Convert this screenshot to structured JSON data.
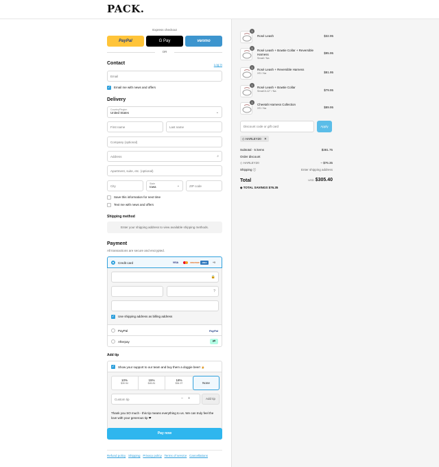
{
  "brand": {
    "logo": "PACK."
  },
  "express": {
    "label": "Express checkout",
    "paypal": "PayPal",
    "gpay": "G Pay",
    "venmo": "venmo",
    "or": "OR"
  },
  "contact": {
    "title": "Contact",
    "login": "Log in",
    "email_placeholder": "Email",
    "news_label": "Email me with news and offers"
  },
  "delivery": {
    "title": "Delivery",
    "country_label": "Country/Region",
    "country_value": "United States",
    "first_name": "First name",
    "last_name": "Last name",
    "company": "Company (optional)",
    "address": "Address",
    "apartment": "Apartment, suite, etc. (optional)",
    "city": "City",
    "state_label": "State",
    "state_value": "Iowa",
    "zip": "ZIP code",
    "save_info": "Save this information for next time",
    "text_me": "Text me with news and offers"
  },
  "shipping_method": {
    "title": "Shipping method",
    "notice": "Enter your shipping address to view available shipping methods."
  },
  "payment": {
    "title": "Payment",
    "subtitle": "All transactions are secure and encrypted.",
    "credit_card": "Credit card",
    "card_brands": [
      "VISA",
      "MC",
      "DISCOVER",
      "AMEX",
      "+5"
    ],
    "billing_same": "Use shipping address as billing address",
    "paypal": "PayPal",
    "paypal_logo": "PayPal",
    "afterpay": "Afterpay"
  },
  "tip": {
    "title": "Add tip",
    "support_label": "Show your support to our team and buy them a doggie beer! 🍺",
    "options": [
      {
        "pct": "10%",
        "amount": "$30.54"
      },
      {
        "pct": "15%",
        "amount": "$45.81"
      },
      {
        "pct": "18%",
        "amount": "$54.97"
      },
      {
        "pct": "None",
        "amount": ""
      }
    ],
    "custom_placeholder": "Custom tip",
    "minus": "−",
    "plus": "+",
    "add_button": "Add tip",
    "thanks": "Thank you SO much - this tip means everything to us. We can truly feel the love with your generous tip ❤"
  },
  "pay_now": "Pay now",
  "footer_links": [
    "Refund policy",
    "Shipping",
    "Privacy policy",
    "Terms of service",
    "Cancellations"
  ],
  "cart": {
    "items": [
      {
        "qty": "1",
        "name": "Rosé Leash",
        "variant": "",
        "price": "$32.95"
      },
      {
        "qty": "1",
        "name": "Rosé Leash + Bowtie Collar + Reversible Harness",
        "variant": "Small / Na",
        "price": "$95.95"
      },
      {
        "qty": "1",
        "name": "Rosé Leash + Reversible Harness",
        "variant": "XS / Na",
        "price": "$81.95"
      },
      {
        "qty": "1",
        "name": "Rosé Leash + Bowtie Collar",
        "variant": "Small 8-12\" / Na",
        "price": "$79.95"
      },
      {
        "qty": "1",
        "name": "Cheetah Harness Collection",
        "variant": "XS / Na",
        "price": "$89.95"
      }
    ],
    "discount_placeholder": "Discount code or gift card",
    "apply": "Apply",
    "code_chip": "HARLEY20",
    "subtotal_label": "Subtotal · 5 items",
    "subtotal_value": "$381.75",
    "order_discount_label": "Order discount",
    "discount_code": "HARLEY20",
    "discount_value": "– $76.35",
    "shipping_label": "Shipping",
    "shipping_value": "Enter shipping address",
    "total_label": "Total",
    "currency": "USD",
    "total_value": "$305.40",
    "savings_label": "TOTAL SAVINGS",
    "savings_value": "$76.35"
  },
  "colors": {
    "accent": "#2fa0dc",
    "paypal": "#ffc439",
    "venmo": "#3d95ce",
    "gpay": "#000000"
  }
}
